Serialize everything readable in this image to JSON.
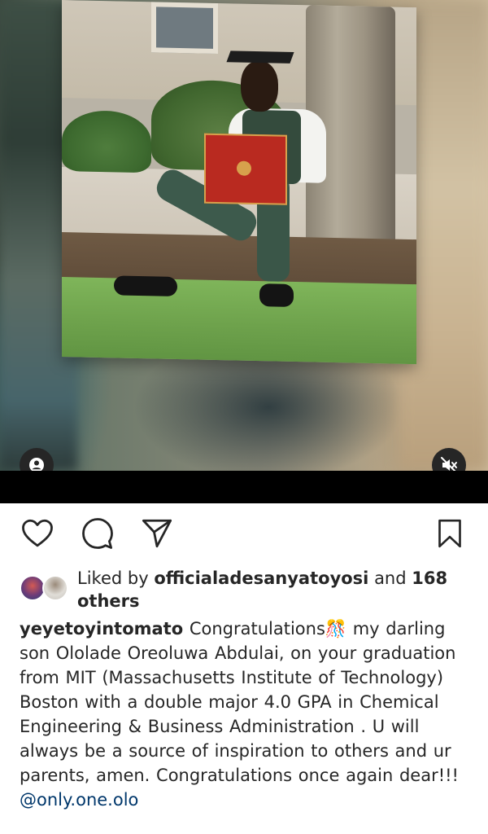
{
  "post": {
    "media": {
      "user_tag_icon": "person-icon",
      "mute_icon": "speaker-muted-icon"
    },
    "actions": {
      "like_icon": "heart-outline-icon",
      "comment_icon": "comment-bubble-icon",
      "share_icon": "paper-plane-icon",
      "save_icon": "bookmark-outline-icon"
    },
    "likes": {
      "prefix": "Liked by ",
      "user": "officialadesanyatoyosi",
      "middle": " and ",
      "count_text": "168 others"
    },
    "caption": {
      "username": "yeyetoyintomato",
      "text": " Congratulations🎊 my darling son Ololade Oreoluwa Abdulai, on your graduation from MIT (Massachusetts Institute of Technology) Boston with a double major 4.0 GPA in  Chemical Engineering & Business Administration .  U will always be a source of inspiration to others and ur parents, amen. Congratulations once again dear!!!",
      "mention": "@only.one.olo"
    }
  },
  "colors": {
    "text": "#262626",
    "mention": "#00376b",
    "background": "#ffffff"
  }
}
